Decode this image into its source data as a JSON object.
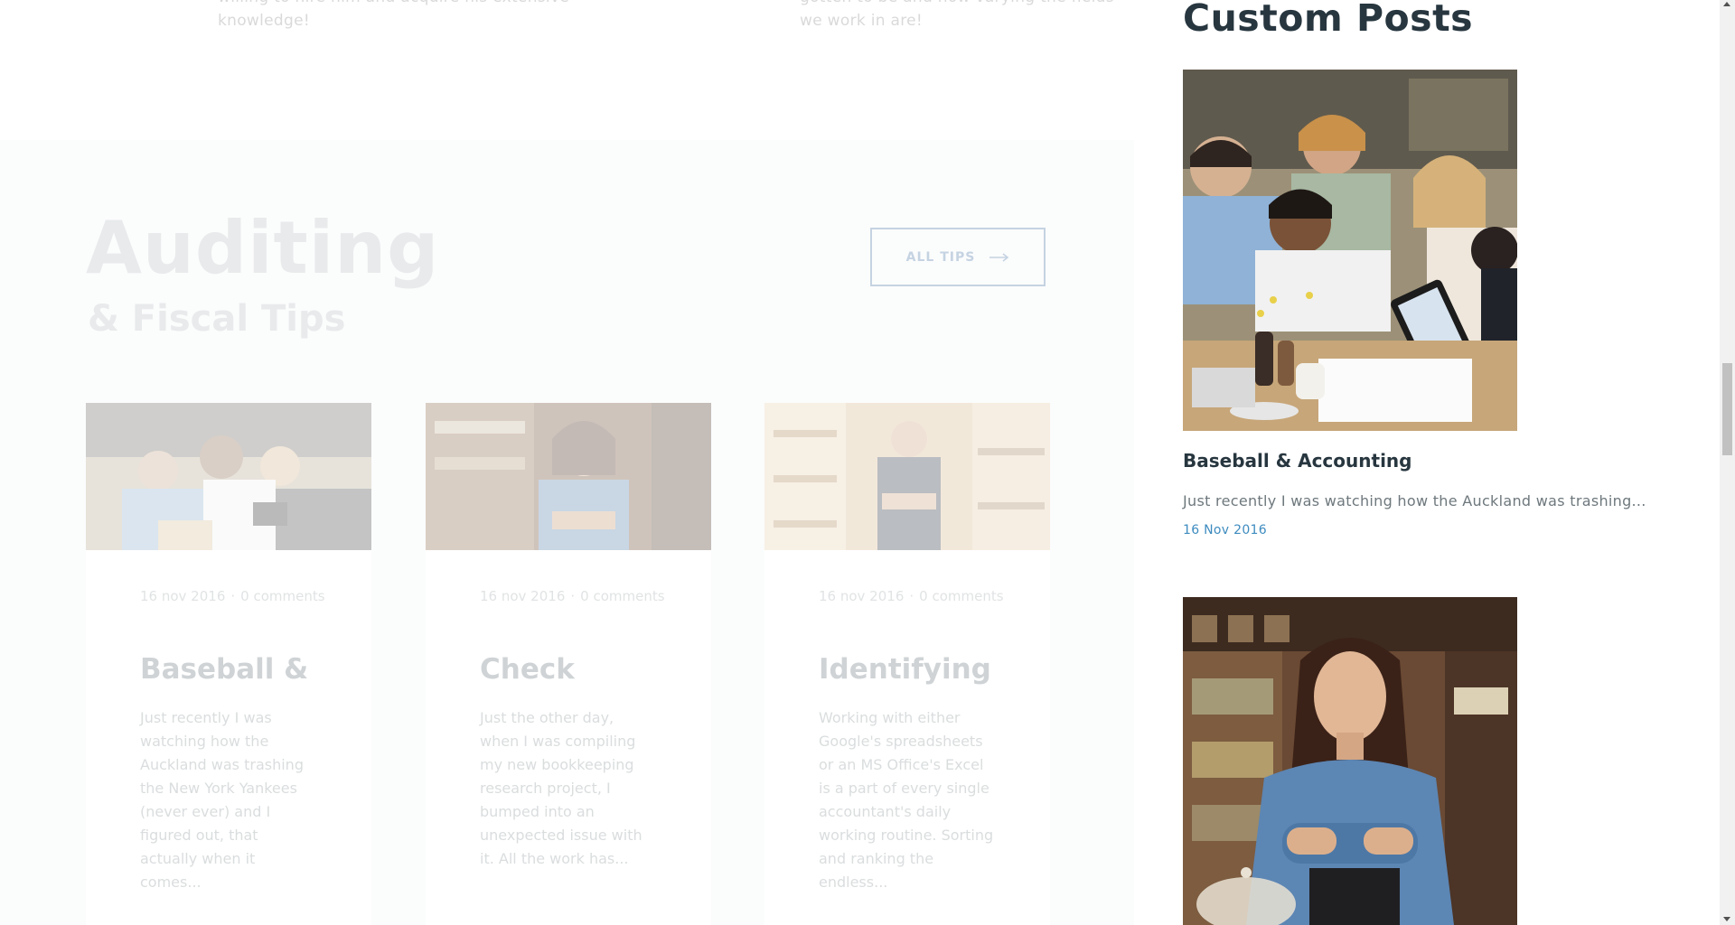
{
  "main": {
    "top_text_left": "willing to hire him and acquire his extensive knowledge!",
    "top_text_right": "gotten to be and how varying the fields we work in are!",
    "heading": "Auditing",
    "subheading": "& Fiscal Tips",
    "all_tips_label": "ALL TIPS",
    "cards": [
      {
        "date": "16 nov 2016",
        "comments": "0 comments",
        "title": "Baseball &",
        "excerpt": "Just recently I was watching how the Auckland was trashing the New York Yankees (never ever) and I figured out, that actually when it comes..."
      },
      {
        "date": "16 nov 2016",
        "comments": "0 comments",
        "title": "Check",
        "excerpt": "Just the other day, when I was compiling my new bookkeeping research project, I bumped into an unexpected issue with it. All the work has..."
      },
      {
        "date": "16 nov 2016",
        "comments": "0 comments",
        "title": "Identifying",
        "excerpt": "Working with either Google's spreadsheets or an MS Office's Excel is a part of every single accountant's daily working routine. Sorting and ranking the endless..."
      }
    ]
  },
  "sidebar": {
    "title": "Custom Posts",
    "post": {
      "title": "Baseball & Accounting",
      "excerpt": "Just recently I was watching how the Auckland was trashing...",
      "date": "16 Nov 2016"
    }
  },
  "colors": {
    "accent": "#3d8bbf",
    "button_border": "#4f79a8",
    "heading": "#27363f"
  },
  "icons": [
    "arrow-right-icon",
    "scroll-up-icon",
    "scroll-down-icon"
  ]
}
